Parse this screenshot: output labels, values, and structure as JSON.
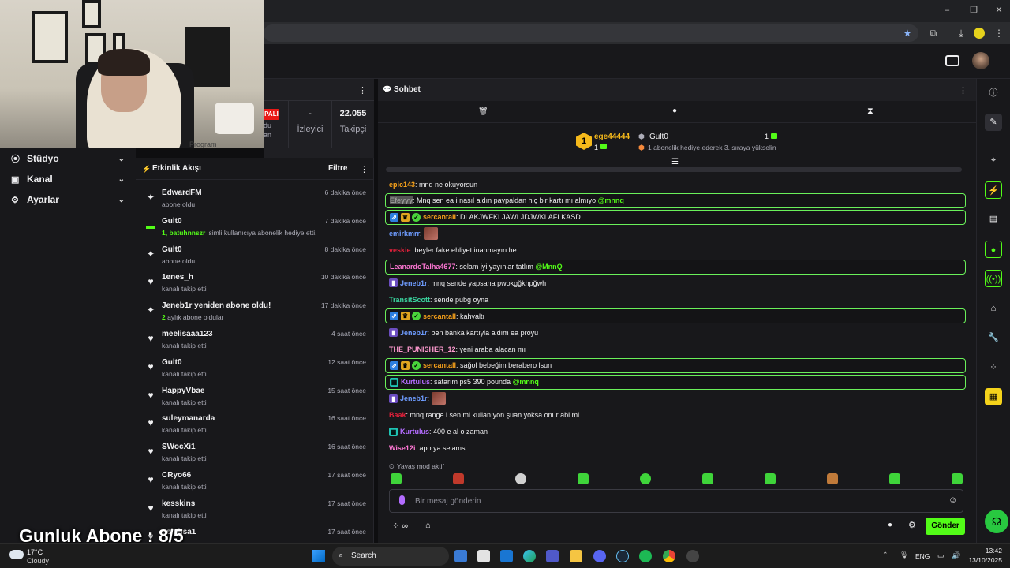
{
  "overlay": {
    "text": "Gunluk Abone : 8/5"
  },
  "sidebar": {
    "items": [
      {
        "label": "Stüdyo"
      },
      {
        "label": "Kanal"
      },
      {
        "label": "Ayarlar"
      }
    ]
  },
  "stats": {
    "live_badge": "PALI",
    "viewers_value": "-",
    "viewers_label": "İzleyici",
    "followers_value": "22.055",
    "followers_label": "Takipçi",
    "partial_label": "Program",
    "partial_left": "du",
    "partial_left2": "an"
  },
  "activity": {
    "title": "Etkinlik Akışı",
    "filter_label": "Filtre",
    "items": [
      {
        "icon": "star",
        "name": "EdwardFM",
        "sub": "abone oldu",
        "time": "6 dakika önce"
      },
      {
        "icon": "gift",
        "name": "Gult0",
        "sub_highlight": "1, batuhnnszr",
        "sub": " isimli kullanıcıya abonelik hediye etti.",
        "time": "7 dakika önce"
      },
      {
        "icon": "star",
        "name": "Gult0",
        "sub": "abone oldu",
        "time": "8 dakika önce"
      },
      {
        "icon": "heart",
        "name": "1enes_h",
        "sub": "kanalı takip etti",
        "time": "10 dakika önce"
      },
      {
        "icon": "star",
        "name": "Jeneb1r yeniden abone oldu!",
        "sub_highlight": "2",
        "sub": " aylık abone oldular",
        "time": "17 dakika önce"
      },
      {
        "icon": "heart",
        "name": "meelisaaa123",
        "sub": "kanalı takip etti",
        "time": "4 saat önce"
      },
      {
        "icon": "heart",
        "name": "Gult0",
        "sub": "kanalı takip etti",
        "time": "12 saat önce"
      },
      {
        "icon": "heart",
        "name": "HappyVbae",
        "sub": "kanalı takip etti",
        "time": "15 saat önce"
      },
      {
        "icon": "heart",
        "name": "suleymanarda",
        "sub": "kanalı takip etti",
        "time": "16 saat önce"
      },
      {
        "icon": "heart",
        "name": "SWocXi1",
        "sub": "kanalı takip etti",
        "time": "16 saat önce"
      },
      {
        "icon": "heart",
        "name": "CRyo66",
        "sub": "kanalı takip etti",
        "time": "17 saat önce"
      },
      {
        "icon": "heart",
        "name": "kesskins",
        "sub": "kanalı takip etti",
        "time": "17 saat önce"
      },
      {
        "icon": "heart",
        "name": "osinhsa1",
        "sub": "",
        "time": "17 saat önce"
      }
    ]
  },
  "chat": {
    "title": "Sohbet",
    "hype": {
      "rank": "1",
      "leader": "ege44444",
      "leader_count": "1",
      "second": "Gult0",
      "second_count": "1",
      "note": "1 abonelik hediye ederek 3. sıraya yükselin"
    },
    "messages": [
      {
        "user": "epic143",
        "color": "#f7a11a",
        "text": ": mnq ne okuyorsun",
        "hl": false,
        "badges": []
      },
      {
        "user": "Efeyyy",
        "color": "#888888",
        "text": ": Mnq sen ea i nasıl aldın paypaldan hiç bir kartı mı almıyo ",
        "mention": "@mnnq",
        "hl": true,
        "badges": []
      },
      {
        "user": "sercantall",
        "color": "#f7a11a",
        "text": ": DLAKJWFKLJAWLJDJWKLAFLKASD",
        "hl": true,
        "badges": [
          "blue",
          "gold",
          "green"
        ]
      },
      {
        "user": "emirkmrr",
        "color": "#6e9cff",
        "text": ": ",
        "emote": true,
        "hl": false,
        "badges": []
      },
      {
        "user": "veskie",
        "color": "#e0203a",
        "text": ": beyler fake ehliyet inanmayın he",
        "hl": false,
        "badges": []
      },
      {
        "user": "LeanardoTalha4677",
        "color": "#ff77d4",
        "text": ": selam iyi yayınlar tatlım ",
        "mention": "@MnnQ",
        "hl": true,
        "badges": []
      },
      {
        "user": "Jeneb1r",
        "color": "#6e9cff",
        "text": ": mnq sende yapsana pwokgğkhpğwh",
        "hl": false,
        "badges": [
          "purple"
        ]
      },
      {
        "user": "TransitScott",
        "color": "#3ad6a0",
        "text": ": sende pubg oyna",
        "hl": false,
        "badges": []
      },
      {
        "user": "sercantall",
        "color": "#f7a11a",
        "text": ": kahvaltı",
        "hl": true,
        "badges": [
          "blue",
          "gold",
          "green"
        ]
      },
      {
        "user": "Jeneb1r",
        "color": "#6e9cff",
        "text": ": ben banka kartıyla aldım ea proyu",
        "hl": false,
        "badges": [
          "purple"
        ]
      },
      {
        "user": "THE_PUNISHER_12",
        "color": "#ff9ad0",
        "text": ": yeni araba alacan mı",
        "hl": false,
        "badges": []
      },
      {
        "user": "sercantall",
        "color": "#f7a11a",
        "text": ": sağol bebeğim berabero lsun",
        "hl": true,
        "badges": [
          "blue",
          "gold",
          "green"
        ]
      },
      {
        "user": "Kurtulus",
        "color": "#b36cff",
        "text": ": satarım ps5 390 pounda ",
        "mention": "@mnnq",
        "hl": true,
        "badges": [
          "teal"
        ]
      },
      {
        "user": "Jeneb1r",
        "color": "#6e9cff",
        "text": ": ",
        "emote": true,
        "hl": false,
        "badges": [
          "purple"
        ]
      },
      {
        "user": "Baak",
        "color": "#e0203a",
        "text": ": mnq range i sen mi kullanıyon şuan yoksa onur abi mi",
        "hl": false,
        "badges": []
      },
      {
        "user": "Kurtulus",
        "color": "#b36cff",
        "text": ": 400 e al o zaman",
        "hl": false,
        "badges": [
          "teal"
        ]
      },
      {
        "user": "Wise12i",
        "color": "#ff77d4",
        "text": ": apo ya selams",
        "hl": false,
        "badges": []
      }
    ],
    "slow_mode": "Yavaş mod aktif",
    "input_placeholder": "Bir mesaj gönderin",
    "send_label": "Gönder"
  },
  "taskbar": {
    "weather_temp": "17°C",
    "weather_desc": "Cloudy",
    "search_label": "Search",
    "lang": "ENG",
    "time": "13:42",
    "date": "13/10/2025"
  },
  "colors": {
    "accent": "#53fc18",
    "bg": "#0e0e10",
    "panel": "#18181b"
  }
}
